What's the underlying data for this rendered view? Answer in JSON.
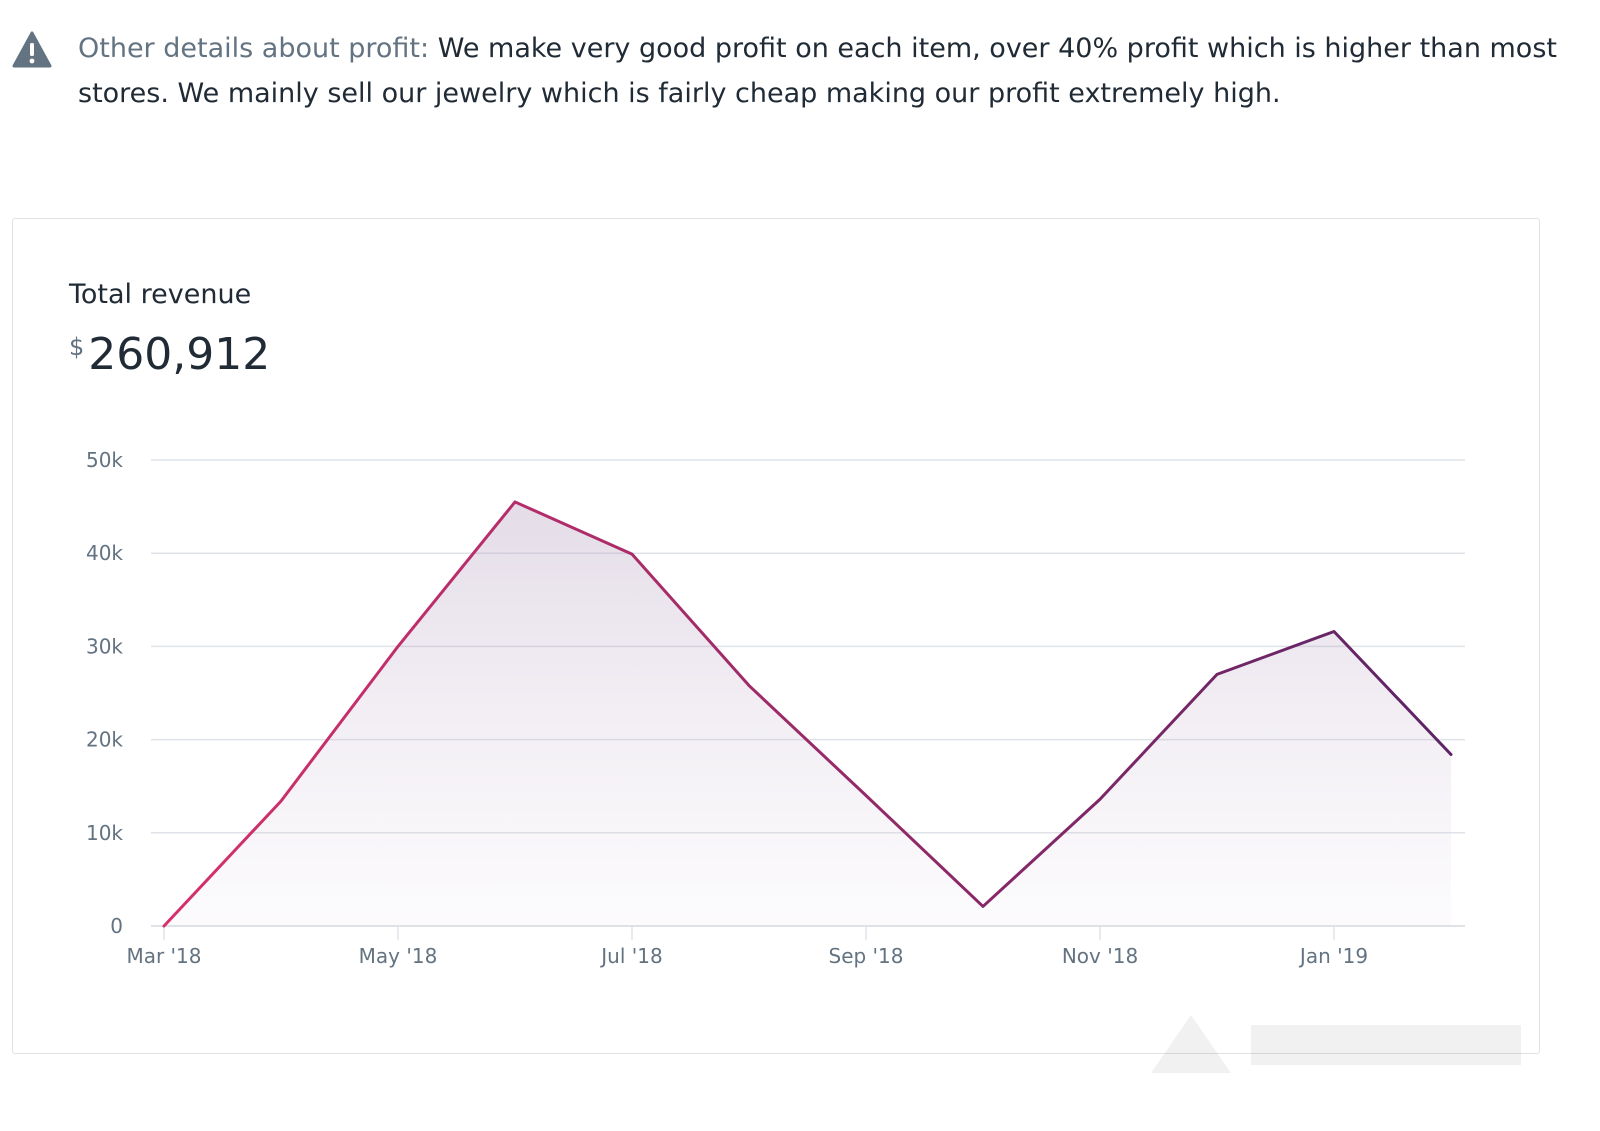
{
  "note": {
    "icon": "warning-icon",
    "label": "Other details about profit:",
    "text": " We make very good profit on each item, over 40% profit which is higher than most stores. We mainly sell our jewelry which is fairly cheap making our profit extremely high."
  },
  "card": {
    "title": "Total revenue",
    "currency": "$",
    "value": "260,912"
  },
  "colors": {
    "line_start": "#d6306b",
    "line_end": "#5c2466",
    "grid": "#dfe3e8",
    "axis_text": "#637381"
  },
  "chart_data": {
    "type": "area",
    "x": [
      "2018-03",
      "2018-04",
      "2018-05",
      "2018-06",
      "2018-07",
      "2018-08",
      "2018-09",
      "2018-10",
      "2018-11",
      "2018-12",
      "2019-01",
      "2019-02"
    ],
    "series": [
      {
        "values": [
          0,
          13400,
          30000,
          45500,
          39900,
          25800,
          14000,
          2100,
          13600,
          27000,
          31600,
          18400
        ]
      }
    ],
    "xticks": [
      {
        "index": 0,
        "label": "Mar '18"
      },
      {
        "index": 2,
        "label": "May '18"
      },
      {
        "index": 4,
        "label": "Jul '18"
      },
      {
        "index": 6,
        "label": "Sep '18"
      },
      {
        "index": 8,
        "label": "Nov '18"
      },
      {
        "index": 10,
        "label": "Jan '19"
      }
    ],
    "yticks": [
      {
        "value": 0,
        "label": "0"
      },
      {
        "value": 10000,
        "label": "10k"
      },
      {
        "value": 20000,
        "label": "20k"
      },
      {
        "value": 30000,
        "label": "30k"
      },
      {
        "value": 40000,
        "label": "40k"
      },
      {
        "value": 50000,
        "label": "50k"
      }
    ],
    "ylim": [
      0,
      50000
    ],
    "grid": true,
    "title": "Total revenue"
  }
}
